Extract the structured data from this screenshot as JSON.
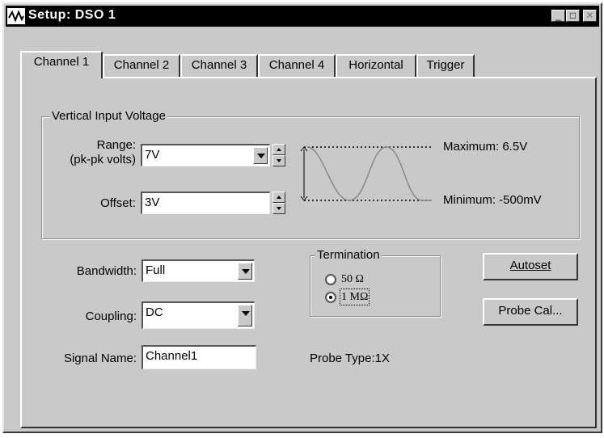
{
  "window": {
    "title": "Setup: DSO 1",
    "icon": "waveform-icon"
  },
  "tabs": [
    {
      "label": "Channel 1",
      "active": true
    },
    {
      "label": "Channel 2",
      "active": false
    },
    {
      "label": "Channel 3",
      "active": false
    },
    {
      "label": "Channel 4",
      "active": false
    },
    {
      "label": "Horizontal",
      "active": false
    },
    {
      "label": "Trigger",
      "active": false
    }
  ],
  "vertical": {
    "group_label": "Vertical Input Voltage",
    "range_label_line1": "Range:",
    "range_label_line2": "(pk-pk volts)",
    "range_value": "7V",
    "offset_label": "Offset:",
    "offset_value": "3V",
    "maximum_text": "Maximum: 6.5V",
    "minimum_text": "Minimum: -500mV"
  },
  "bandwidth": {
    "label": "Bandwidth:",
    "value": "Full"
  },
  "coupling": {
    "label": "Coupling:",
    "value": "DC"
  },
  "signal_name": {
    "label": "Signal Name:",
    "value": "Channel1"
  },
  "termination": {
    "group_label": "Termination",
    "options": [
      {
        "label": "50 Ω",
        "checked": false
      },
      {
        "label": "1 MΩ",
        "checked": true
      }
    ]
  },
  "probe_type_text": "Probe Type:1X",
  "buttons": {
    "autoset": "Autoset",
    "probe_cal": "Probe Cal..."
  },
  "colors": {
    "dialog_bg": "#c9c9c9",
    "titlebar_bg": "#000000",
    "waveform": "#888888"
  }
}
